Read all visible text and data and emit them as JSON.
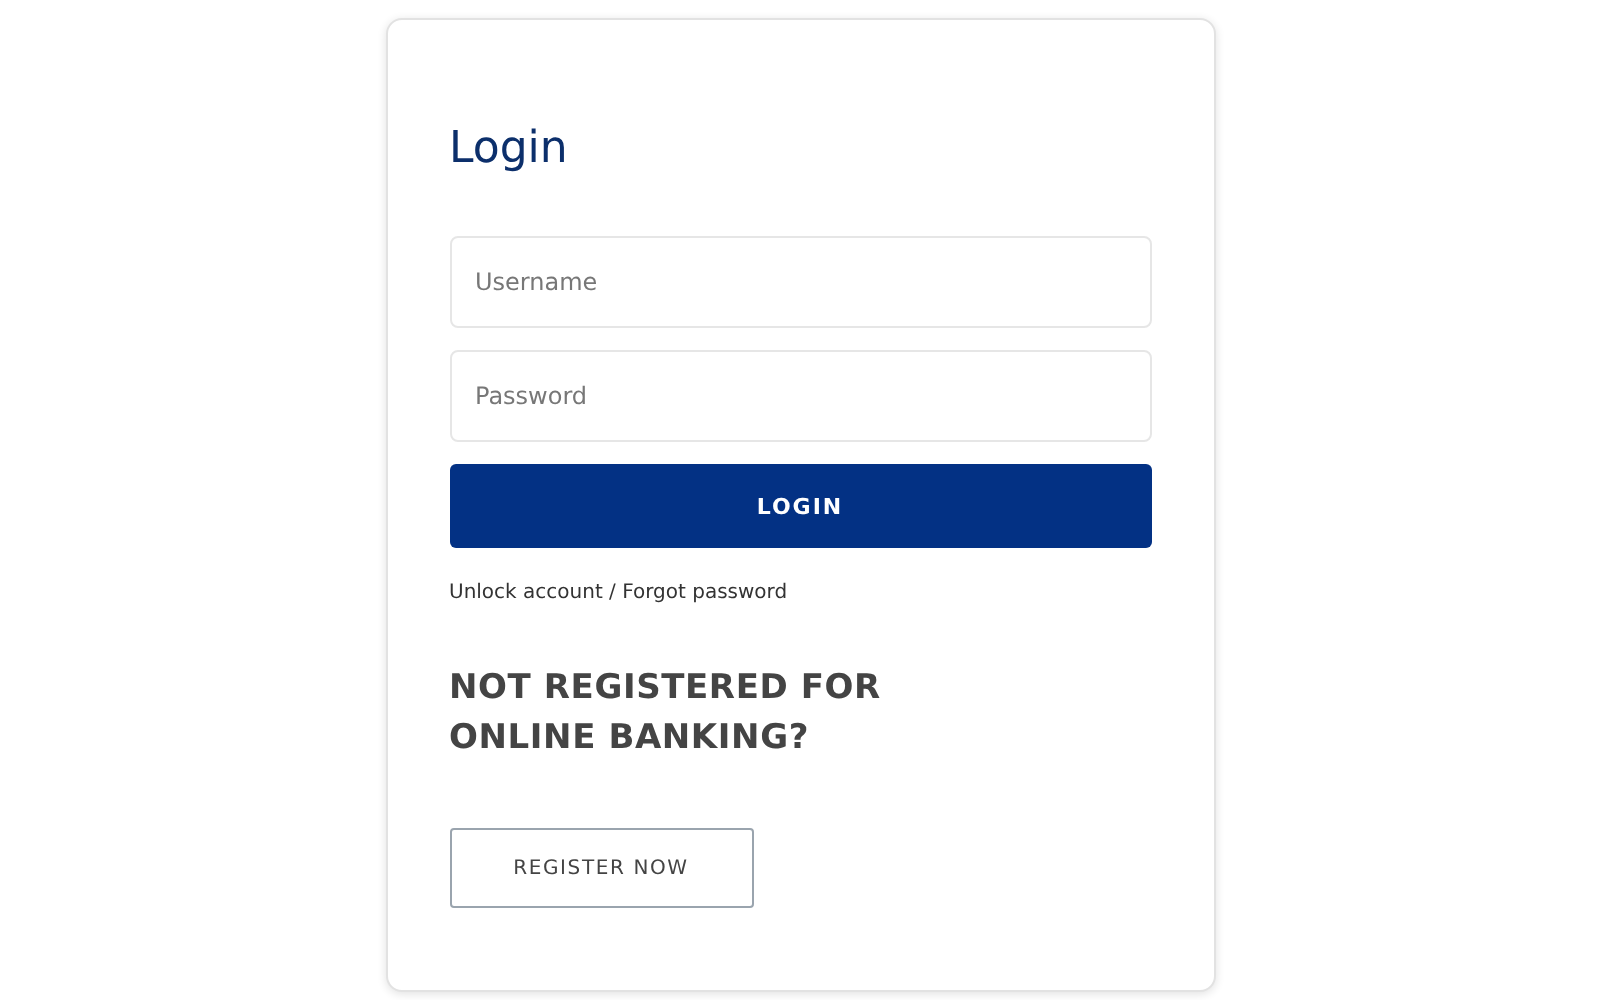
{
  "title": "Login",
  "fields": [
    {
      "placeholder": "Username"
    },
    {
      "placeholder": "Password"
    }
  ],
  "login_button": "LOGIN",
  "help_link": "Unlock account / Forgot password",
  "register_heading": "NOT REGISTERED FOR ONLINE BANKING?",
  "register_button": "REGISTER NOW"
}
